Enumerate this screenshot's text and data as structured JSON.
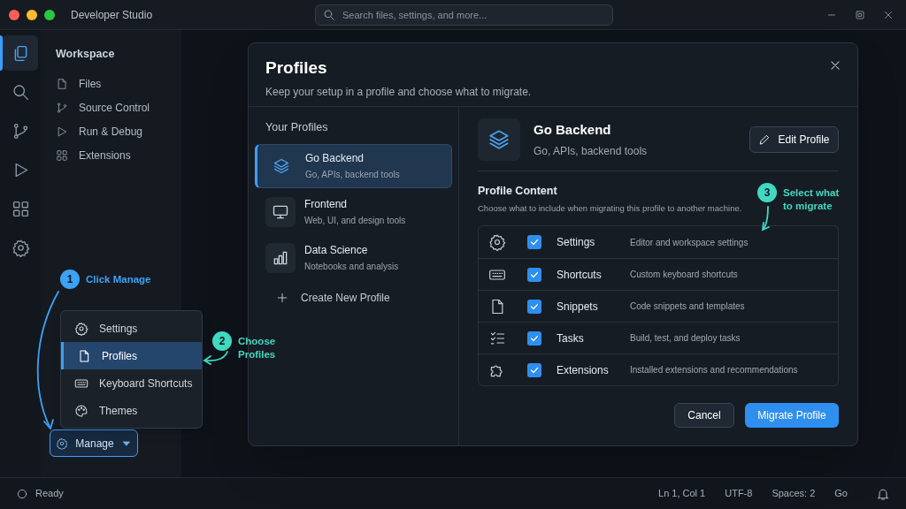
{
  "window": {
    "title": "Developer Studio"
  },
  "search": {
    "placeholder": "Search files, settings, and more..."
  },
  "activity_bar": {
    "items": [
      {
        "selected": true
      },
      {
        "selected": false
      },
      {
        "selected": false
      },
      {
        "selected": false
      },
      {
        "selected": false
      },
      {
        "selected": false
      }
    ]
  },
  "sidebar": {
    "title": "Workspace",
    "items": [
      "Files",
      "Source Control",
      "Run & Debug",
      "Extensions"
    ]
  },
  "manage_menu": {
    "items": [
      {
        "label": "Settings",
        "selected": false
      },
      {
        "label": "Profiles",
        "selected": true
      },
      {
        "label": "Keyboard Shortcuts",
        "selected": false
      },
      {
        "label": "Themes",
        "selected": false
      }
    ]
  },
  "manage_button": {
    "label": "Manage"
  },
  "annotations": [
    {
      "number": "1",
      "text": "Click Manage",
      "color": "#3ba3f5"
    },
    {
      "number": "2",
      "text": "Choose Profiles",
      "color": "#3fd9c2"
    },
    {
      "number": "3",
      "text": "Select what to migrate",
      "color": "#3fd9c2"
    }
  ],
  "dialog": {
    "title": "Profiles",
    "subtitle": "Keep your setup in a profile and choose what to migrate.",
    "profiles_heading": "Your Profiles",
    "profiles": [
      {
        "name": "Go Backend",
        "description": "Go, APIs, backend tools",
        "selected": true
      },
      {
        "name": "Frontend",
        "description": "Web, UI, and design tools",
        "selected": false
      },
      {
        "name": "Data Science",
        "description": "Notebooks and analysis",
        "selected": false
      }
    ],
    "create_label": "Create New Profile",
    "detail": {
      "name": "Go Backend",
      "description": "Go, APIs, backend tools",
      "edit_button": "Edit Profile"
    },
    "content_heading": "Profile Content",
    "content_hint": "Choose what to include when migrating this profile to another machine.",
    "content_items": [
      {
        "label": "Settings",
        "description": "Editor and workspace settings",
        "checked": true
      },
      {
        "label": "Shortcuts",
        "description": "Custom keyboard shortcuts",
        "checked": true
      },
      {
        "label": "Snippets",
        "description": "Code snippets and templates",
        "checked": true
      },
      {
        "label": "Tasks",
        "description": "Build, test, and deploy tasks",
        "checked": true
      },
      {
        "label": "Extensions",
        "description": "Installed extensions and recommendations",
        "checked": true
      }
    ],
    "cancel_button": "Cancel",
    "primary_button": "Migrate Profile"
  },
  "status_bar": {
    "status": "Ready",
    "items": [
      "Ln 1, Col 1",
      "UTF-8",
      "Spaces: 2",
      "Go"
    ]
  }
}
